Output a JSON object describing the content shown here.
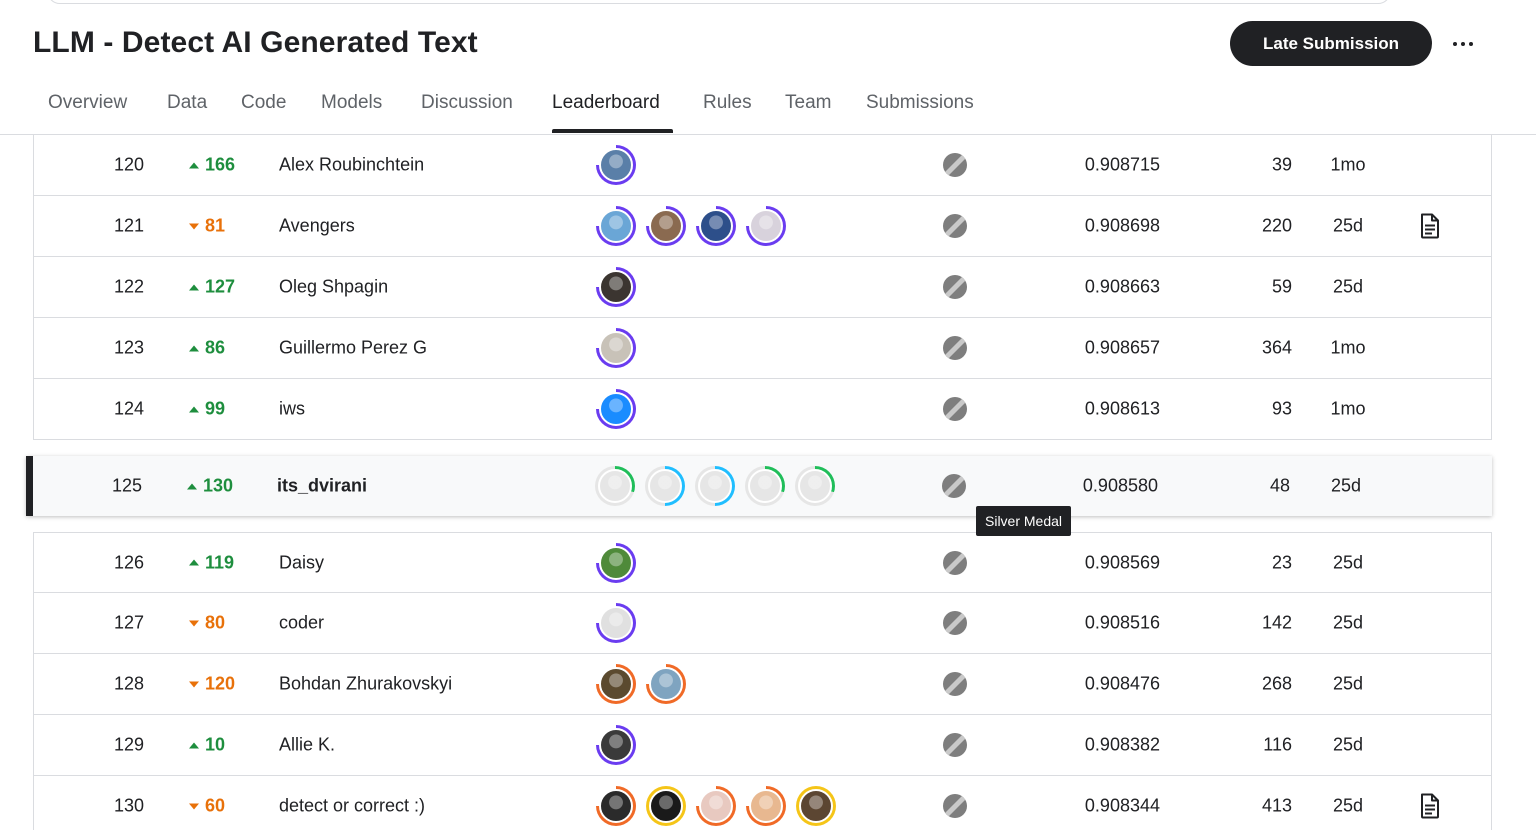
{
  "title": "LLM - Detect AI Generated Text",
  "actions": {
    "late_submission": "Late Submission",
    "more_icon": "more-horiz-icon"
  },
  "tabs": [
    "Overview",
    "Data",
    "Code",
    "Models",
    "Discussion",
    "Leaderboard",
    "Rules",
    "Team",
    "Submissions"
  ],
  "active_tab": "Leaderboard",
  "tooltip": "Silver Medal",
  "colors": {
    "up": "#1e8e3e",
    "down": "#e8710a",
    "ring_purple": "#6a3cf0",
    "ring_green": "#20be5a",
    "ring_blue": "#20beff",
    "ring_orange": "#f06a27",
    "ring_gold": "#f5c518",
    "dark": "#202124"
  },
  "rows": [
    {
      "rank": "120",
      "dir": "up",
      "delta": "166",
      "team": "Alex Roubinchtein",
      "avatars": [
        {
          "ring": "purple",
          "fill": "#5a7fa8"
        }
      ],
      "score": "0.908715",
      "entries": "39",
      "last": "1mo",
      "notebook": false
    },
    {
      "rank": "121",
      "dir": "down",
      "delta": "81",
      "team": "Avengers",
      "avatars": [
        {
          "ring": "purple",
          "fill": "#6aa6d6"
        },
        {
          "ring": "purple",
          "fill": "#8a6a50"
        },
        {
          "ring": "purple",
          "fill": "#2d4f8a"
        },
        {
          "ring": "purple",
          "fill": "#d8d2dc"
        }
      ],
      "score": "0.908698",
      "entries": "220",
      "last": "25d",
      "notebook": true
    },
    {
      "rank": "122",
      "dir": "up",
      "delta": "127",
      "team": "Oleg Shpagin",
      "avatars": [
        {
          "ring": "purple",
          "fill": "#3b3530"
        }
      ],
      "score": "0.908663",
      "entries": "59",
      "last": "25d",
      "notebook": false
    },
    {
      "rank": "123",
      "dir": "up",
      "delta": "86",
      "team": "Guillermo Perez G",
      "avatars": [
        {
          "ring": "purple",
          "fill": "#c8c2b8"
        }
      ],
      "score": "0.908657",
      "entries": "364",
      "last": "1mo",
      "notebook": false
    },
    {
      "rank": "124",
      "dir": "up",
      "delta": "99",
      "team": "iws",
      "avatars": [
        {
          "ring": "purple",
          "fill": "#1a8cff"
        }
      ],
      "score": "0.908613",
      "entries": "93",
      "last": "1mo",
      "notebook": false
    },
    {
      "rank": "125",
      "dir": "up",
      "delta": "130",
      "team": "its_dvirani",
      "avatars": [
        {
          "ring": "green",
          "fill": "#e6e6e6"
        },
        {
          "ring": "blue",
          "fill": "#e6e6e6"
        },
        {
          "ring": "blue",
          "fill": "#e6e6e6"
        },
        {
          "ring": "green",
          "fill": "#e6e6e6"
        },
        {
          "ring": "green",
          "fill": "#e6e6e6"
        }
      ],
      "score": "0.908580",
      "entries": "48",
      "last": "25d",
      "notebook": false,
      "current_user": true
    },
    {
      "rank": "126",
      "dir": "up",
      "delta": "119",
      "team": "Daisy",
      "avatars": [
        {
          "ring": "purple",
          "fill": "#4f8a3a"
        }
      ],
      "score": "0.908569",
      "entries": "23",
      "last": "25d",
      "notebook": false
    },
    {
      "rank": "127",
      "dir": "down",
      "delta": "80",
      "team": "coder",
      "avatars": [
        {
          "ring": "purple",
          "fill": "#e0e0e0"
        }
      ],
      "score": "0.908516",
      "entries": "142",
      "last": "25d",
      "notebook": false
    },
    {
      "rank": "128",
      "dir": "down",
      "delta": "120",
      "team": "Bohdan Zhurakovskyi",
      "avatars": [
        {
          "ring": "orange",
          "fill": "#5b4a2f"
        },
        {
          "ring": "orange",
          "fill": "#7fa4c0"
        }
      ],
      "score": "0.908476",
      "entries": "268",
      "last": "25d",
      "notebook": false
    },
    {
      "rank": "129",
      "dir": "up",
      "delta": "10",
      "team": "Allie K.",
      "avatars": [
        {
          "ring": "purple",
          "fill": "#3a3a3a"
        }
      ],
      "score": "0.908382",
      "entries": "116",
      "last": "25d",
      "notebook": false
    },
    {
      "rank": "130",
      "dir": "down",
      "delta": "60",
      "team": "detect or correct :)",
      "avatars": [
        {
          "ring": "orange",
          "fill": "#2b2b2b"
        },
        {
          "ring": "gold",
          "fill": "#1a1a1a"
        },
        {
          "ring": "orange",
          "fill": "#e8c9c0"
        },
        {
          "ring": "orange",
          "fill": "#e8b890"
        },
        {
          "ring": "gold",
          "fill": "#5c4632"
        }
      ],
      "score": "0.908344",
      "entries": "413",
      "last": "25d",
      "notebook": true
    }
  ]
}
